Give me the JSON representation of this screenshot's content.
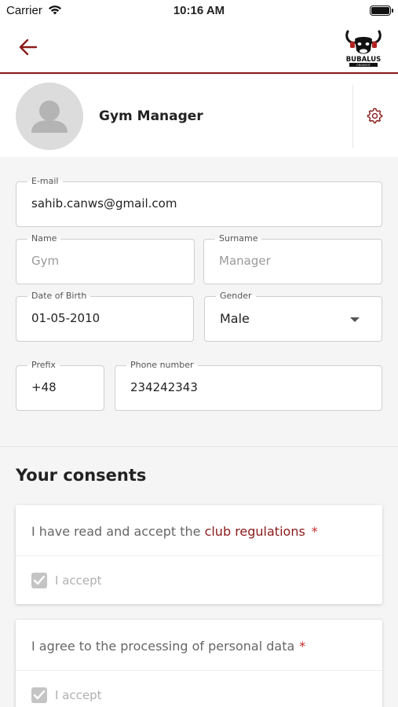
{
  "status": {
    "carrier": "Carrier",
    "time": "10:16 AM"
  },
  "header": {
    "logo_text": "BUBALUS",
    "logo_sub": "CROSSFIT"
  },
  "profile": {
    "name": "Gym Manager"
  },
  "form": {
    "email": {
      "label": "E-mail",
      "value": "sahib.canws@gmail.com"
    },
    "name": {
      "label": "Name",
      "placeholder": "Gym"
    },
    "surname": {
      "label": "Surname",
      "placeholder": "Manager"
    },
    "dob": {
      "label": "Date of Birth",
      "value": "01-05-2010"
    },
    "gender": {
      "label": "Gender",
      "value": "Male"
    },
    "prefix": {
      "label": "Prefix",
      "value": "+48"
    },
    "phone": {
      "label": "Phone number",
      "value": "234242343"
    }
  },
  "consents": {
    "title": "Your consents",
    "items": [
      {
        "text_before": "I have read and accept the ",
        "link": "club regulations",
        "required": "*",
        "accept_label": "I accept",
        "checked": true
      },
      {
        "text_before": "I agree to the processing of personal data",
        "link": "",
        "required": "*",
        "accept_label": "I accept",
        "checked": true
      }
    ]
  },
  "colors": {
    "accent": "#8b1a1a",
    "required": "#c62828",
    "background": "#f5f5f5"
  }
}
